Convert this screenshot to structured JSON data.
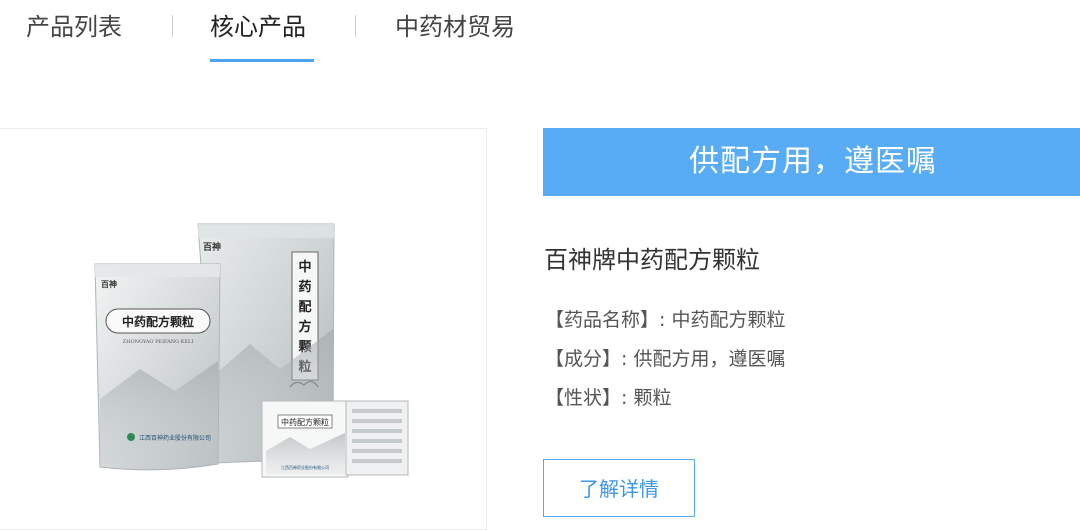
{
  "tabs": [
    {
      "label": "产品列表",
      "active": false
    },
    {
      "label": "核心产品",
      "active": true
    },
    {
      "label": "中药材贸易",
      "active": false
    }
  ],
  "banner": {
    "text": "供配方用，遵医嘱"
  },
  "product": {
    "title": "百神牌中药配方颗粒",
    "details": [
      "【药品名称】: 中药配方颗粒",
      "【成分】: 供配方用，遵医嘱",
      "【性状】: 颗粒"
    ],
    "button_label": "了解详情",
    "package": {
      "brand_mark": "百神",
      "name": "中药配方颗粒",
      "pinyin": "ZHONGYAO PEIFANG KELI",
      "vertical_name": "中药配方颗粒",
      "company": "江西百神药业股份有限公司",
      "company_short": "江西百神"
    }
  },
  "colors": {
    "accent": "#58abf5",
    "tab_underline": "#4aa3f5",
    "button_text": "#3d97e8"
  }
}
